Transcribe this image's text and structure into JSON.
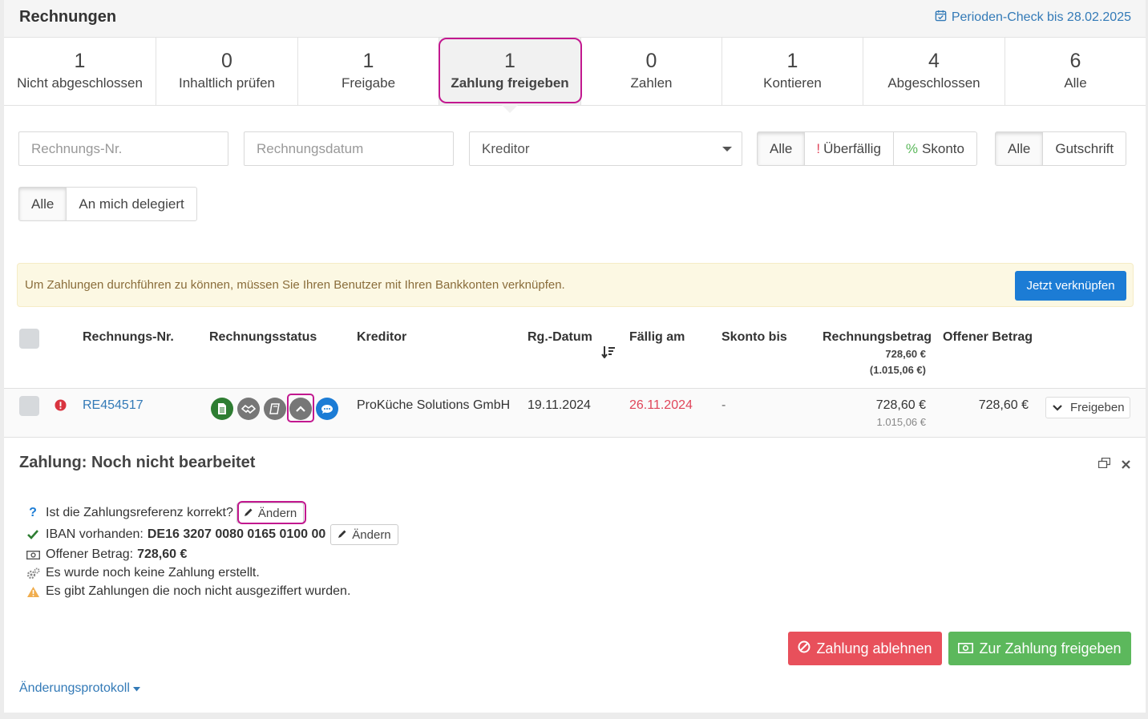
{
  "header": {
    "title": "Rechnungen",
    "period_check": "Perioden-Check bis 28.02.2025"
  },
  "tabs": [
    {
      "count": "1",
      "label": "Nicht abgeschlossen"
    },
    {
      "count": "0",
      "label": "Inhaltlich prüfen"
    },
    {
      "count": "1",
      "label": "Freigabe"
    },
    {
      "count": "1",
      "label": "Zahlung freigeben"
    },
    {
      "count": "0",
      "label": "Zahlen"
    },
    {
      "count": "1",
      "label": "Kontieren"
    },
    {
      "count": "4",
      "label": "Abgeschlossen"
    },
    {
      "count": "6",
      "label": "Alle"
    }
  ],
  "filters": {
    "invoice_no_placeholder": "Rechnungs-Nr.",
    "invoice_date_placeholder": "Rechnungsdatum",
    "creditor_placeholder": "Kreditor",
    "due_group": {
      "all": "Alle",
      "overdue_mark": "!",
      "overdue": "Überfällig",
      "discount_mark": "%",
      "discount": "Skonto"
    },
    "type_group": {
      "all": "Alle",
      "credit": "Gutschrift"
    },
    "delegate_group": {
      "all": "Alle",
      "me": "An mich delegiert"
    }
  },
  "alert": {
    "text": "Um Zahlungen durchführen zu können, müssen Sie Ihren Benutzer mit Ihren Bankkonten verknüpfen.",
    "button": "Jetzt verknüpfen"
  },
  "table": {
    "headers": {
      "invoice_no": "Rechnungs-Nr.",
      "status": "Rechnungsstatus",
      "creditor": "Kreditor",
      "date": "Rg.-Datum",
      "due": "Fällig am",
      "discount": "Skonto bis",
      "amount": "Rechnungsbetrag",
      "amount_sum": "728,60 €",
      "amount_sum_gross": "(1.015,06 €)",
      "open": "Offener Betrag"
    },
    "rows": [
      {
        "invoice_no": "RE454517",
        "creditor": "ProKüche Solutions GmbH",
        "date": "19.11.2024",
        "due": "26.11.2024",
        "discount": "-",
        "amount": "728,60 €",
        "amount_gross": "1.015,06 €",
        "open": "728,60 €",
        "action": "Freigeben"
      }
    ]
  },
  "detail": {
    "title": "Zahlung: Noch nicht bearbeitet",
    "q_reference": "Ist die Zahlungsreferenz korrekt?",
    "change": "Ändern",
    "iban_label": "IBAN vorhanden:",
    "iban_value": "DE16 3207 0080 0165 0100 00",
    "open_label": "Offener Betrag:",
    "open_value": "728,60 €",
    "no_payment": "Es wurde noch keine Zahlung erstellt.",
    "unreconciled": "Es gibt Zahlungen die noch nicht ausgeziffert wurden.",
    "reject_button": "Zahlung ablehnen",
    "approve_button": "Zur Zahlung freigeben",
    "changelog": "Änderungsprotokoll"
  },
  "colors": {
    "accent": "#337ab7",
    "primary_button": "#1c7cd5",
    "danger": "#e8505b",
    "success": "#5cb85c",
    "highlight": "#c2188f",
    "due_red": "#e0455a"
  }
}
